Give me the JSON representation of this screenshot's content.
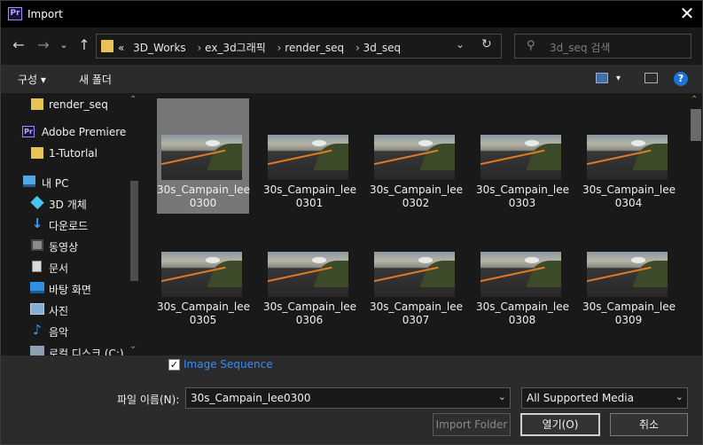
{
  "window": {
    "app_icon": "Pr",
    "title": "Import",
    "close_glyph": "✕"
  },
  "nav": {
    "back": "←",
    "forward": "→",
    "recent": "⌄",
    "up": "↑",
    "breadcrumb_prefix": "«",
    "breadcrumbs": [
      "3D_Works",
      "ex_3d그래픽",
      "render_seq",
      "3d_seq"
    ],
    "crumb_sep": "›",
    "dropdown": "⌄",
    "refresh": "↻",
    "search_icon": "⚲",
    "search_placeholder": "3d_seq 검색"
  },
  "toolbar": {
    "organize": "구성 ▾",
    "new_folder": "새 폴더",
    "view_dropdown": "▾",
    "help": "?"
  },
  "sidebar": {
    "items": [
      {
        "label": "render_seq",
        "icon": "folder-icon"
      },
      {
        "label": "Adobe Premiere F",
        "icon": "premiere-icon"
      },
      {
        "label": "1-Tutorlal",
        "icon": "folder-icon"
      },
      {
        "label": "내 PC",
        "icon": "pc-icon"
      },
      {
        "label": "3D 개체",
        "icon": "3d-objects-icon"
      },
      {
        "label": "다운로드",
        "icon": "download-icon"
      },
      {
        "label": "동영상",
        "icon": "video-icon"
      },
      {
        "label": "문서",
        "icon": "document-icon"
      },
      {
        "label": "바탕 화면",
        "icon": "desktop-icon"
      },
      {
        "label": "사진",
        "icon": "pictures-icon"
      },
      {
        "label": "음악",
        "icon": "music-icon"
      },
      {
        "label": "로컬 디스크 (C:)",
        "icon": "disk-icon"
      }
    ],
    "scroll_up": "⌃",
    "scroll_down": "⌄"
  },
  "files": {
    "items": [
      {
        "line1": "30s_Campain_lee",
        "line2": "0300",
        "selected": true
      },
      {
        "line1": "30s_Campain_lee",
        "line2": "0301"
      },
      {
        "line1": "30s_Campain_lee",
        "line2": "0302"
      },
      {
        "line1": "30s_Campain_lee",
        "line2": "0303"
      },
      {
        "line1": "30s_Campain_lee",
        "line2": "0304"
      },
      {
        "line1": "30s_Campain_lee",
        "line2": "0305"
      },
      {
        "line1": "30s_Campain_lee",
        "line2": "0306"
      },
      {
        "line1": "30s_Campain_lee",
        "line2": "0307"
      },
      {
        "line1": "30s_Campain_lee",
        "line2": "0308"
      },
      {
        "line1": "30s_Campain_lee",
        "line2": "0309"
      }
    ],
    "scroll_up": "⌃"
  },
  "bottom": {
    "image_sequence_checked": true,
    "check_glyph": "✓",
    "image_sequence_label": "Image Sequence",
    "filename_label": "파일 이름(N):",
    "filename_value": "30s_Campain_lee0300",
    "dropdown": "⌄",
    "filetype_value": "All Supported Media",
    "import_folder": "Import Folder",
    "open": "열기(O)",
    "cancel": "취소"
  }
}
